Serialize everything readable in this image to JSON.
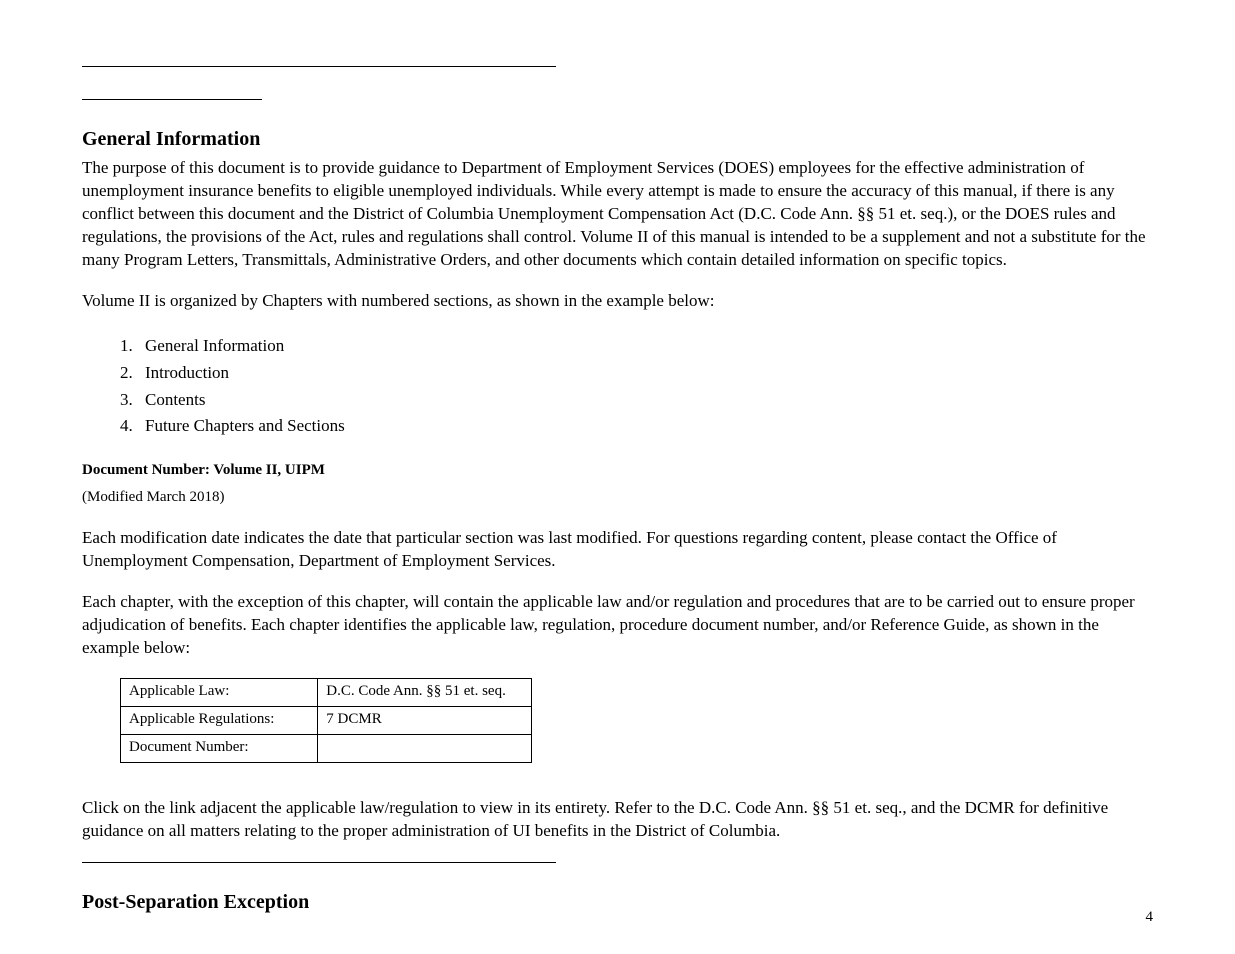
{
  "section_title": "General Information",
  "intro_para": "The purpose of this document is to provide guidance to Department of Employment Services (DOES) employees for the effective administration of unemployment insurance benefits to eligible unemployed individuals. While every attempt is made to ensure the accuracy of this manual, if there is any conflict between this document and the District of Columbia Unemployment Compensation Act (D.C. Code Ann. §§ 51 et. seq.), or the DOES rules and regulations, the provisions of the Act, rules and regulations shall control. Volume II of this manual is intended to be a supplement and not a substitute for the many Program Letters, Transmittals, Administrative Orders, and other documents which contain detailed information on specific topics.",
  "vol2_para": "Volume II is organized by Chapters with numbered sections, as shown in the example below:",
  "list_items": [
    "General Information",
    "Introduction",
    "Contents",
    "Future Chapters and Sections"
  ],
  "subhead": "Document Number: Volume II, UIPM",
  "modified": "(Modified March 2018)",
  "para2": "Each modification date indicates the date that particular section was last modified. For questions regarding content, please contact the Office of Unemployment Compensation, Department of Employment Services.",
  "para3": "Each chapter, with the exception of this chapter, will contain the applicable law and/or regulation and procedures that are to be carried out to ensure proper adjudication of benefits. Each chapter identifies the applicable law, regulation, procedure document number, and/or Reference Guide, as shown in the example below:",
  "table": {
    "rows": [
      [
        "Applicable Law:",
        "D.C. Code Ann. §§ 51 et. seq."
      ],
      [
        "Applicable Regulations:",
        "7 DCMR"
      ],
      [
        "Document Number:",
        ""
      ]
    ]
  },
  "para4": "Click on the link adjacent the applicable law/regulation to view in its entirety. Refer to the D.C. Code Ann. §§ 51 et. seq., and the DCMR for definitive guidance on all matters relating to the proper administration of UI benefits in the District of Columbia.",
  "post_exception": "Post-Separation Exception",
  "page_number": "4"
}
